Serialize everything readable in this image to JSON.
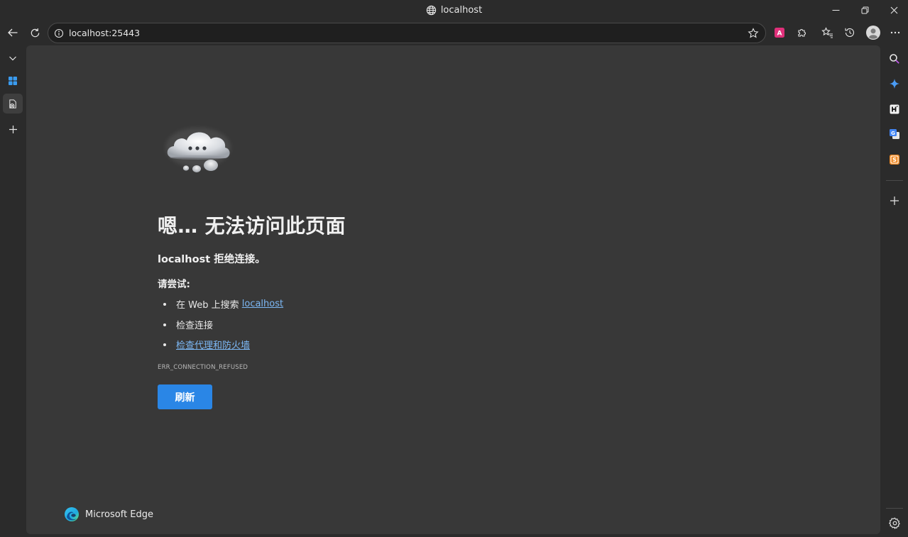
{
  "window": {
    "title": "localhost",
    "globe_icon": "globe-icon",
    "controls": [
      "minimize-icon",
      "restore-icon",
      "close-icon"
    ]
  },
  "toolbar": {
    "url": "localhost:25443",
    "back_icon": "back-arrow-icon",
    "refresh_icon": "refresh-icon",
    "favorite_icon": "star-icon",
    "extensions": [
      "translate-extension-icon",
      "puzzle-extensions-icon",
      "favorites-icon",
      "history-icon",
      "profile-avatar",
      "more-icon"
    ]
  },
  "left_tabs": [
    "tab-actions-chevron-icon",
    "workspaces-icon",
    "active-tab-favicon",
    "new-tab-plus-icon"
  ],
  "right_sidebar": [
    "search-icon",
    "copilot-icon",
    "h-app-icon",
    "google-translate-icon",
    "s-app-icon",
    "add-app-icon",
    "settings-gear-icon"
  ],
  "error": {
    "title": "嗯… 无法访问此页面",
    "host": "localhost",
    "refused": " 拒绝连接。",
    "try_label": "请尝试:",
    "suggestions": {
      "search_prefix": "在 Web 上搜索 ",
      "search_link": "localhost",
      "check_connection": "检查连接",
      "check_proxy": "检查代理和防火墙"
    },
    "code": "ERR_CONNECTION_REFUSED",
    "refresh_label": "刷新"
  },
  "brand": {
    "name": "Microsoft Edge"
  },
  "colors": {
    "accent": "#2a86e6",
    "link": "#7cb8f5",
    "page_bg": "#383838",
    "chrome_bg": "#2b2b2b"
  }
}
